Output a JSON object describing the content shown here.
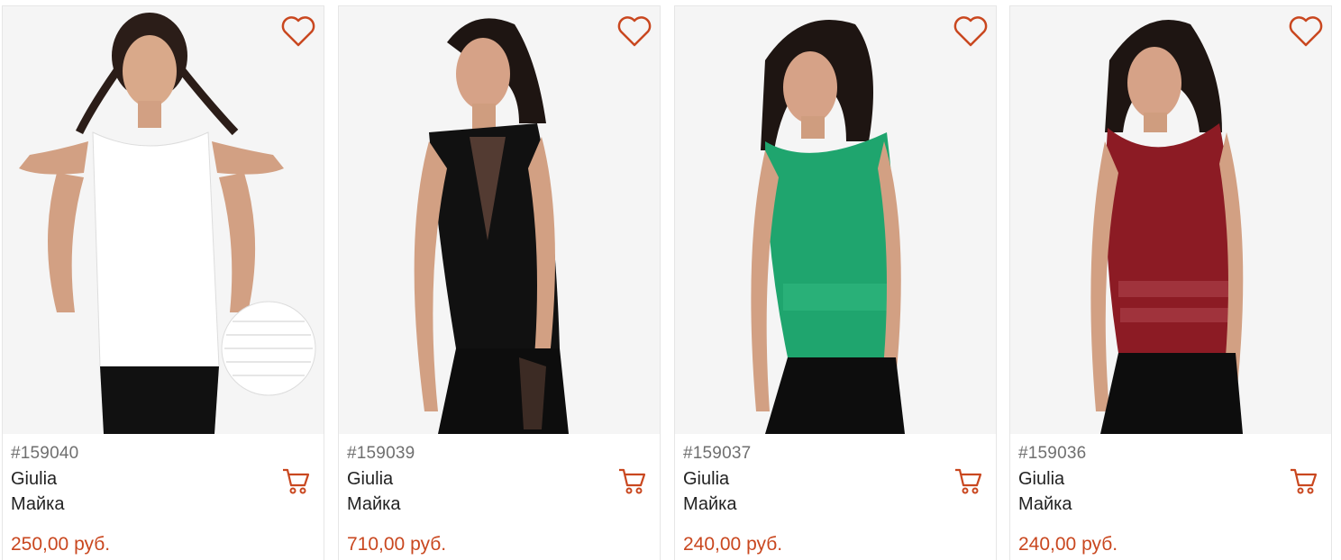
{
  "colors": {
    "accent": "#c9471f",
    "sku": "#6f6f6f",
    "text": "#222222",
    "border": "#e6e6e6"
  },
  "icons": {
    "favorite": "heart-icon",
    "cart": "cart-icon"
  },
  "products": [
    {
      "sku": "#159040",
      "brand": "Giulia",
      "kind": "Майка",
      "price": "250,00 руб.",
      "top_color": "#ffffff"
    },
    {
      "sku": "#159039",
      "brand": "Giulia",
      "kind": "Майка",
      "price": "710,00 руб.",
      "top_color": "#111111"
    },
    {
      "sku": "#159037",
      "brand": "Giulia",
      "kind": "Майка",
      "price": "240,00 руб.",
      "top_color": "#1fa56e"
    },
    {
      "sku": "#159036",
      "brand": "Giulia",
      "kind": "Майка",
      "price": "240,00 руб.",
      "top_color": "#8c1b24"
    }
  ]
}
